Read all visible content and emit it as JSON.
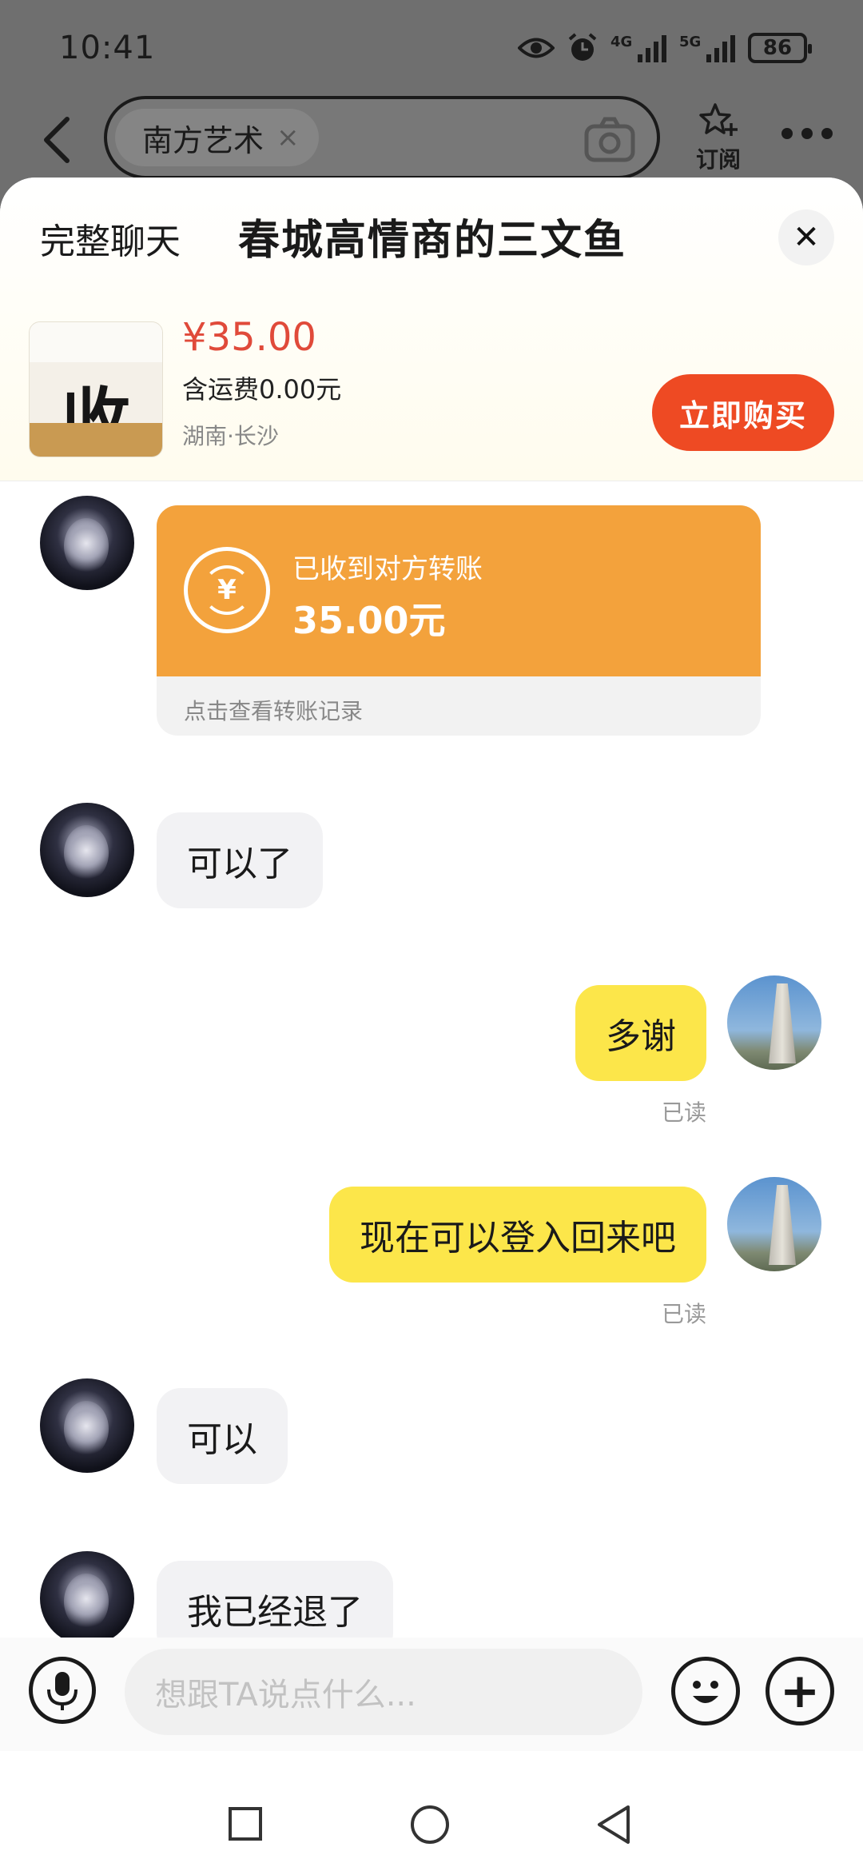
{
  "status": {
    "time": "10:41",
    "network1": "4G",
    "network2": "5G",
    "battery": "86"
  },
  "search": {
    "chip_text": "南方艺术",
    "chip_clear": "×",
    "subscribe_label": "订阅"
  },
  "sheet": {
    "full_chat_label": "完整聊天",
    "title": "春城高情商的三文鱼",
    "close_label": "✕"
  },
  "product": {
    "price": "¥35.00",
    "shipping": "含运费0.00元",
    "location": "湖南·长沙",
    "buy_label": "立即购买",
    "image_char": "收"
  },
  "transfer": {
    "icon_glyph": "¥",
    "label": "已收到对方转账",
    "amount": "35.00元",
    "link": "点击查看转账记录"
  },
  "messages": [
    {
      "from": "other",
      "text": "可以了"
    },
    {
      "from": "self",
      "text": "多谢",
      "status": "已读"
    },
    {
      "from": "self",
      "text": "现在可以登入回来吧",
      "status": "已读"
    },
    {
      "from": "other",
      "text": "可以"
    },
    {
      "from": "other",
      "text": "我已经退了"
    }
  ],
  "composer": {
    "placeholder": "想跟TA说点什么..."
  },
  "colors": {
    "accent_orange": "#ee4a23",
    "price_red": "#e04a3a",
    "transfer_orange": "#f3a23c",
    "self_bubble": "#fce64a"
  },
  "icons": [
    "eye-icon",
    "alarm-icon",
    "signal-icon",
    "battery-icon",
    "back-icon",
    "camera-icon",
    "subscribe-star-icon",
    "more-icon",
    "close-icon",
    "yen-transfer-icon",
    "microphone-icon",
    "emoji-icon",
    "plus-icon",
    "nav-recent-icon",
    "nav-home-icon",
    "nav-back-icon"
  ]
}
